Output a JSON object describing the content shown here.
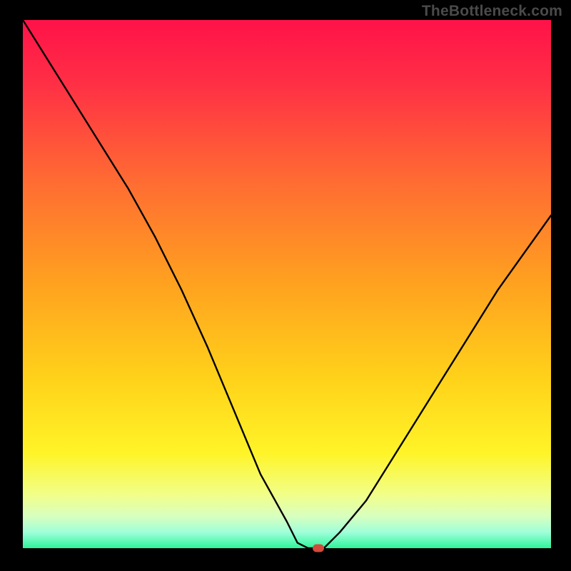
{
  "watermark": "TheBottleneck.com",
  "colors": {
    "frame": "#000000",
    "curve": "#000000",
    "marker": "#d24a3a",
    "gradient_top": "#ff1249",
    "gradient_bottom": "#2ef59b"
  },
  "chart_data": {
    "type": "line",
    "title": "",
    "xlabel": "",
    "ylabel": "",
    "xlim": [
      0,
      100
    ],
    "ylim": [
      0,
      100
    ],
    "grid": false,
    "legend": false,
    "x": [
      0,
      5,
      10,
      15,
      20,
      25,
      30,
      35,
      40,
      45,
      50,
      52,
      54,
      55,
      57,
      60,
      65,
      70,
      75,
      80,
      85,
      90,
      95,
      100
    ],
    "values": [
      100,
      92,
      84,
      76,
      68,
      59,
      49,
      38,
      26,
      14,
      5,
      1,
      0,
      0,
      0,
      3,
      9,
      17,
      25,
      33,
      41,
      49,
      56,
      63
    ],
    "marker": {
      "x": 56,
      "y": 0
    }
  }
}
